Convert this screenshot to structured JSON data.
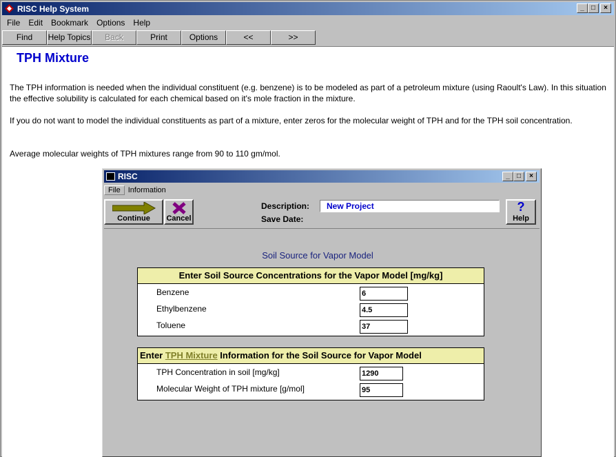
{
  "app": {
    "title": "RISC Help System",
    "window_buttons": [
      "_",
      "□",
      "×"
    ]
  },
  "menu": [
    "File",
    "Edit",
    "Bookmark",
    "Options",
    "Help"
  ],
  "toolbar": [
    {
      "label": "Find",
      "enabled": true
    },
    {
      "label": "Help Topics",
      "enabled": true
    },
    {
      "label": "Back",
      "enabled": false
    },
    {
      "label": "Print",
      "enabled": true
    },
    {
      "label": "Options",
      "enabled": true
    },
    {
      "label": "<<",
      "enabled": true
    },
    {
      "label": ">>",
      "enabled": true
    }
  ],
  "help": {
    "title": "TPH Mixture",
    "paragraphs": [
      "The TPH information is needed when the individual constituent (e.g. benzene) is to be modeled as part of a petroleum mixture (using Raoult's Law).  In this situation the effective solubility is calculated for each chemical based on it's mole fraction in the mixture.",
      "If you do not want to model the individual constituents as part of a mixture, enter zeros for the molecular weight of TPH and for the TPH soil concentration.",
      "Average molecular weights of TPH mixtures range from 90 to 110 gm/mol."
    ]
  },
  "risc": {
    "title": "RISC",
    "menu": [
      "File",
      "Information"
    ],
    "continue_label": "Continue",
    "cancel_label": "Cancel",
    "help_label": "Help",
    "description_label": "Description:",
    "description_value": "New Project",
    "save_date_label": "Save Date:",
    "section_title": "Soil Source for Vapor Model",
    "panel1": {
      "heading": "Enter Soil Source Concentrations for the Vapor Model [mg/kg]",
      "rows": [
        {
          "label": "Benzene",
          "value": "6"
        },
        {
          "label": "Ethylbenzene",
          "value": "4.5"
        },
        {
          "label": "Toluene",
          "value": "37"
        }
      ]
    },
    "panel2": {
      "heading_prefix": "Enter ",
      "heading_link": "TPH Mixture",
      "heading_suffix": " Information for the Soil Source for Vapor Model",
      "rows": [
        {
          "label": "TPH Concentration in soil [mg/kg]",
          "value": "1290"
        },
        {
          "label": "Molecular Weight of TPH mixture [g/mol]",
          "value": "95"
        }
      ]
    }
  },
  "colors": {
    "titlebar_start": "#0a246a",
    "titlebar_end": "#a6caf0",
    "help_title": "#0000cc",
    "panel_header_bg": "#eeeeaa",
    "section_title": "#1a237e"
  }
}
